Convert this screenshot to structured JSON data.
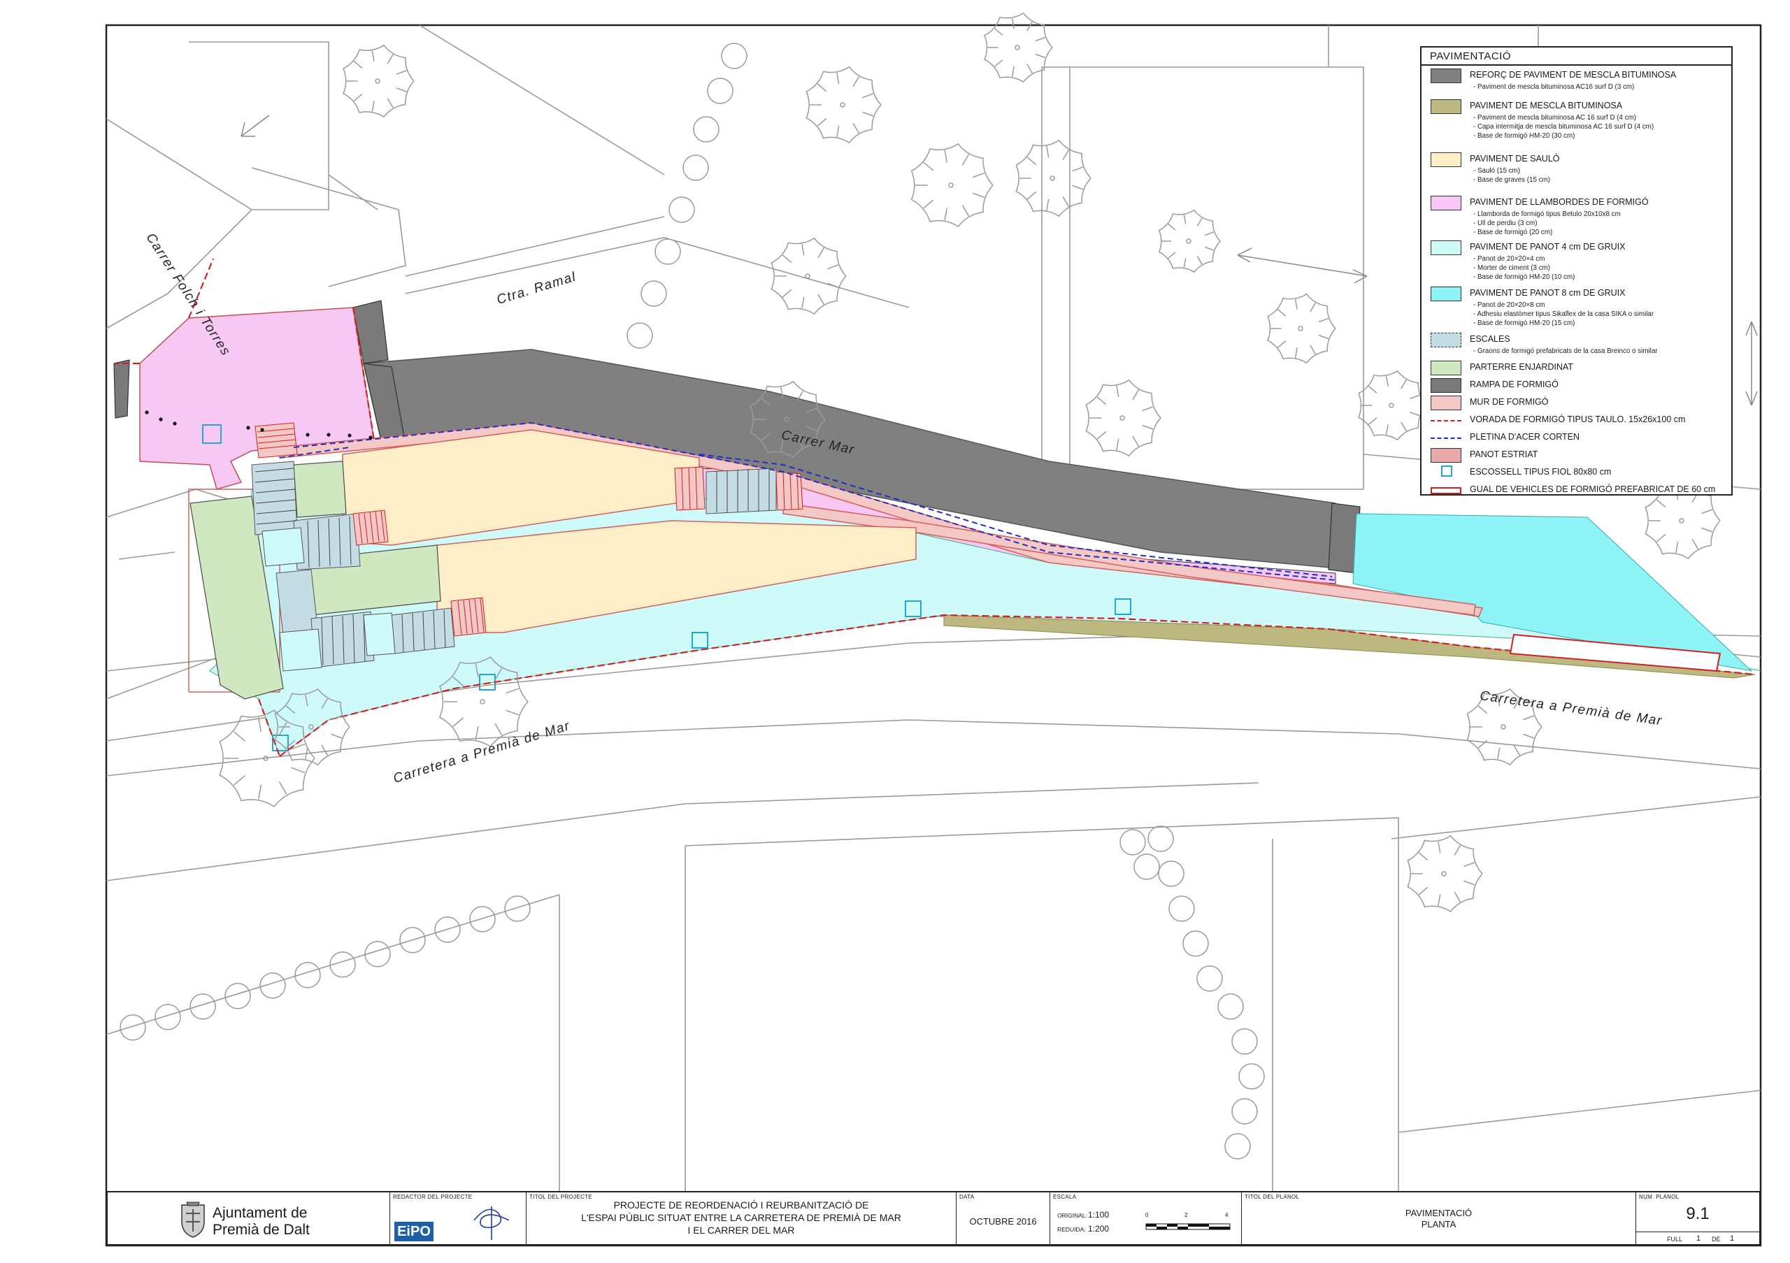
{
  "legend": {
    "title": "PAVIMENTACIÓ",
    "items": [
      {
        "label": "REFORÇ DE PAVIMENT DE MESCLA BITUMINOSA",
        "color": "#808080",
        "notes": [
          "- Paviment de mescla bituminosa AC16 surf D (3 cm)"
        ]
      },
      {
        "label": "PAVIMENT DE MESCLA BITUMINOSA",
        "color": "#bdb880",
        "notes": [
          "- Paviment de mescla bituminosa AC 16 surf D (4 cm)",
          "- Capa intermitja de mescla bituminosa AC 16 surf D (4 cm)",
          "- Base de formigó HM-20 (30 cm)"
        ]
      },
      {
        "label": "PAVIMENT DE SAULÓ",
        "color": "#fdeec8",
        "notes": [
          "- Sauló (15 cm)",
          "- Base de graves (15 cm)"
        ]
      },
      {
        "label": "PAVIMENT DE LLAMBORDES DE FORMIGÓ",
        "color": "#f8c8f4",
        "notes": [
          "- Llamborda de formigó tipus Betulo 20x10x8 cm",
          "- Ull de perdiu (3 cm)",
          "- Base de formigó (20 cm)"
        ]
      },
      {
        "label": "PAVIMENT DE PANOT 4 cm DE GRUIX",
        "color": "#cffafa",
        "notes": [
          "- Panot de 20×20×4 cm",
          "- Morter de ciment (3 cm)",
          "- Base de formigó HM-20 (10 cm)"
        ]
      },
      {
        "label": "PAVIMENT DE PANOT 8 cm DE GRUIX",
        "color": "#8ef4f8",
        "notes": [
          "- Panot de 20×20×8 cm",
          "- Adhesiu elastòmer tipus Sikaflex de la casa SIKA o similar",
          "- Base de formigó HM-20 (15 cm)"
        ]
      },
      {
        "label": "ESCALES",
        "color": "#c4dce4",
        "notes": [
          "- Graons de formigó prefabricats de la casa Breinco o similar"
        ]
      },
      {
        "label": "PARTERRE ENJARDINAT",
        "color": "#cfe8c0",
        "notes": []
      },
      {
        "label": "RAMPA DE FORMIGÓ",
        "color": "#7a7a7a",
        "notes": []
      },
      {
        "label": "MUR DE FORMIGÓ",
        "color": "#f4c8c4",
        "notes": []
      },
      {
        "label": "VORADA DE FORMIGÓ TIPUS TAULO. 15x26x100 cm",
        "color": "#d02020",
        "notes": []
      },
      {
        "label": "PLETINA D'ACER CORTEN",
        "color": "#2030c0",
        "notes": []
      },
      {
        "label": "PANOT ESTRIAT",
        "color": "#e8a8a8",
        "notes": []
      },
      {
        "label": "ESCOSSELL TIPUS FIOL 80x80 cm",
        "color": "#20a8d0",
        "notes": []
      },
      {
        "label": "GUAL DE VEHICLES DE FORMIGÓ PREFABRICAT DE 60 cm",
        "color": "#d02020",
        "notes": []
      }
    ]
  },
  "streets": {
    "carrer_folch": "Carrer Folch i Torres",
    "ctra_ramal": "Ctra. Ramal",
    "carrer_mar": "Carrer Mar",
    "carretera_left": "Carretera a Premià de Mar",
    "carretera_right": "Carretera a Premià de Mar"
  },
  "title_block": {
    "client_line1": "Ajuntament de",
    "client_line2": "Premià de Dalt",
    "redactor_caption": "REDACTOR DEL PROJECTE",
    "redactor_logo": "EiPO",
    "project_caption": "TITOL DEL PROJECTE",
    "project_line1": "PROJECTE DE REORDENACIÓ I REURBANITZACIÓ DE",
    "project_line2": "L'ESPAI PÚBLIC SITUAT ENTRE LA CARRETERA DE PREMIÀ DE MAR",
    "project_line3": "I EL CARRER DEL MAR",
    "date_caption": "DATA",
    "date": "OCTUBRE 2016",
    "scale_caption": "ESCALA",
    "scale_original_label": "ORIGINAL:",
    "scale_original": "1:100",
    "scale_reduced_label": "REDUIDA:",
    "scale_reduced": "1:200",
    "scale_ticks": [
      "0",
      "2",
      "4"
    ],
    "plan_caption": "TITOL DEL PLANOL",
    "plan_title_line1": "PAVIMENTACIÓ",
    "plan_title_line2": "PLANTA",
    "plan_num_caption": "NUM. PLANOL",
    "plan_num": "9.1",
    "sheet_label": "FULL",
    "sheet_num": "1",
    "sheet_of": "DE",
    "sheet_total": "1"
  }
}
